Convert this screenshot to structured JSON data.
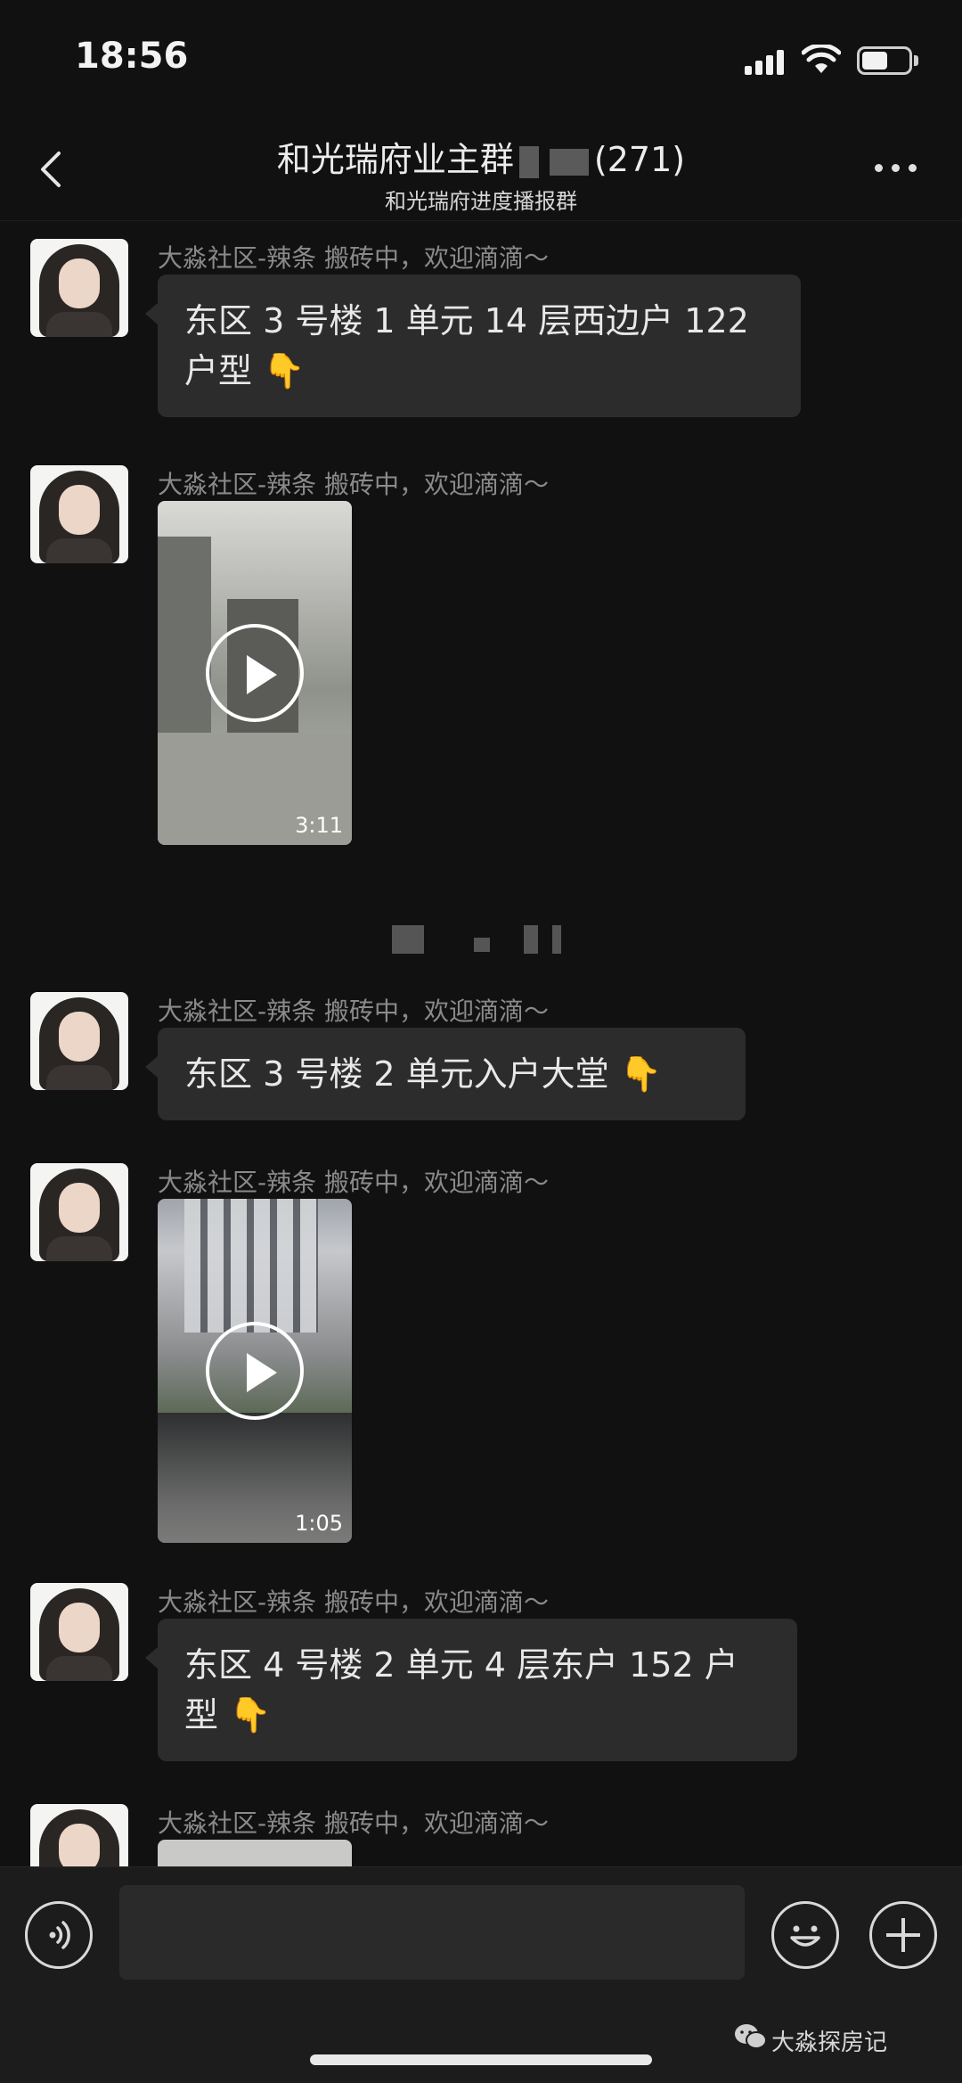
{
  "status_bar": {
    "time": "18:56",
    "battery_level": 0.55
  },
  "header": {
    "title": "和光瑞府业主群",
    "member_count": "(271)",
    "subtitle": "和光瑞府进度播报群"
  },
  "messages": [
    {
      "sender": "大淼社区-辣条 搬砖中，欢迎滴滴～",
      "type": "text",
      "text": "东区 3 号楼 1 单元 14 层西边户 122 户型",
      "emoji": "👇"
    },
    {
      "sender": "大淼社区-辣条 搬砖中，欢迎滴滴～",
      "type": "video",
      "duration": "3:11"
    },
    {
      "sender": "大淼社区-辣条 搬砖中，欢迎滴滴～",
      "type": "text",
      "text": "东区 3 号楼 2 单元入户大堂",
      "emoji": "👇"
    },
    {
      "sender": "大淼社区-辣条 搬砖中，欢迎滴滴～",
      "type": "video",
      "duration": "1:05"
    },
    {
      "sender": "大淼社区-辣条 搬砖中，欢迎滴滴～",
      "type": "text",
      "text": "东区 4 号楼 2 单元 4 层东户 152 户型",
      "emoji": "👇"
    },
    {
      "sender": "大淼社区-辣条 搬砖中，欢迎滴滴～",
      "type": "video"
    }
  ],
  "input_bar": {
    "value": "",
    "placeholder": ""
  },
  "watermark": "大淼探房记",
  "icons": {
    "back": "back-chevron-icon",
    "more": "more-dots-icon",
    "voice": "voice-icon",
    "emoji": "emoji-icon",
    "plus": "plus-icon",
    "wechat": "wechat-icon"
  }
}
